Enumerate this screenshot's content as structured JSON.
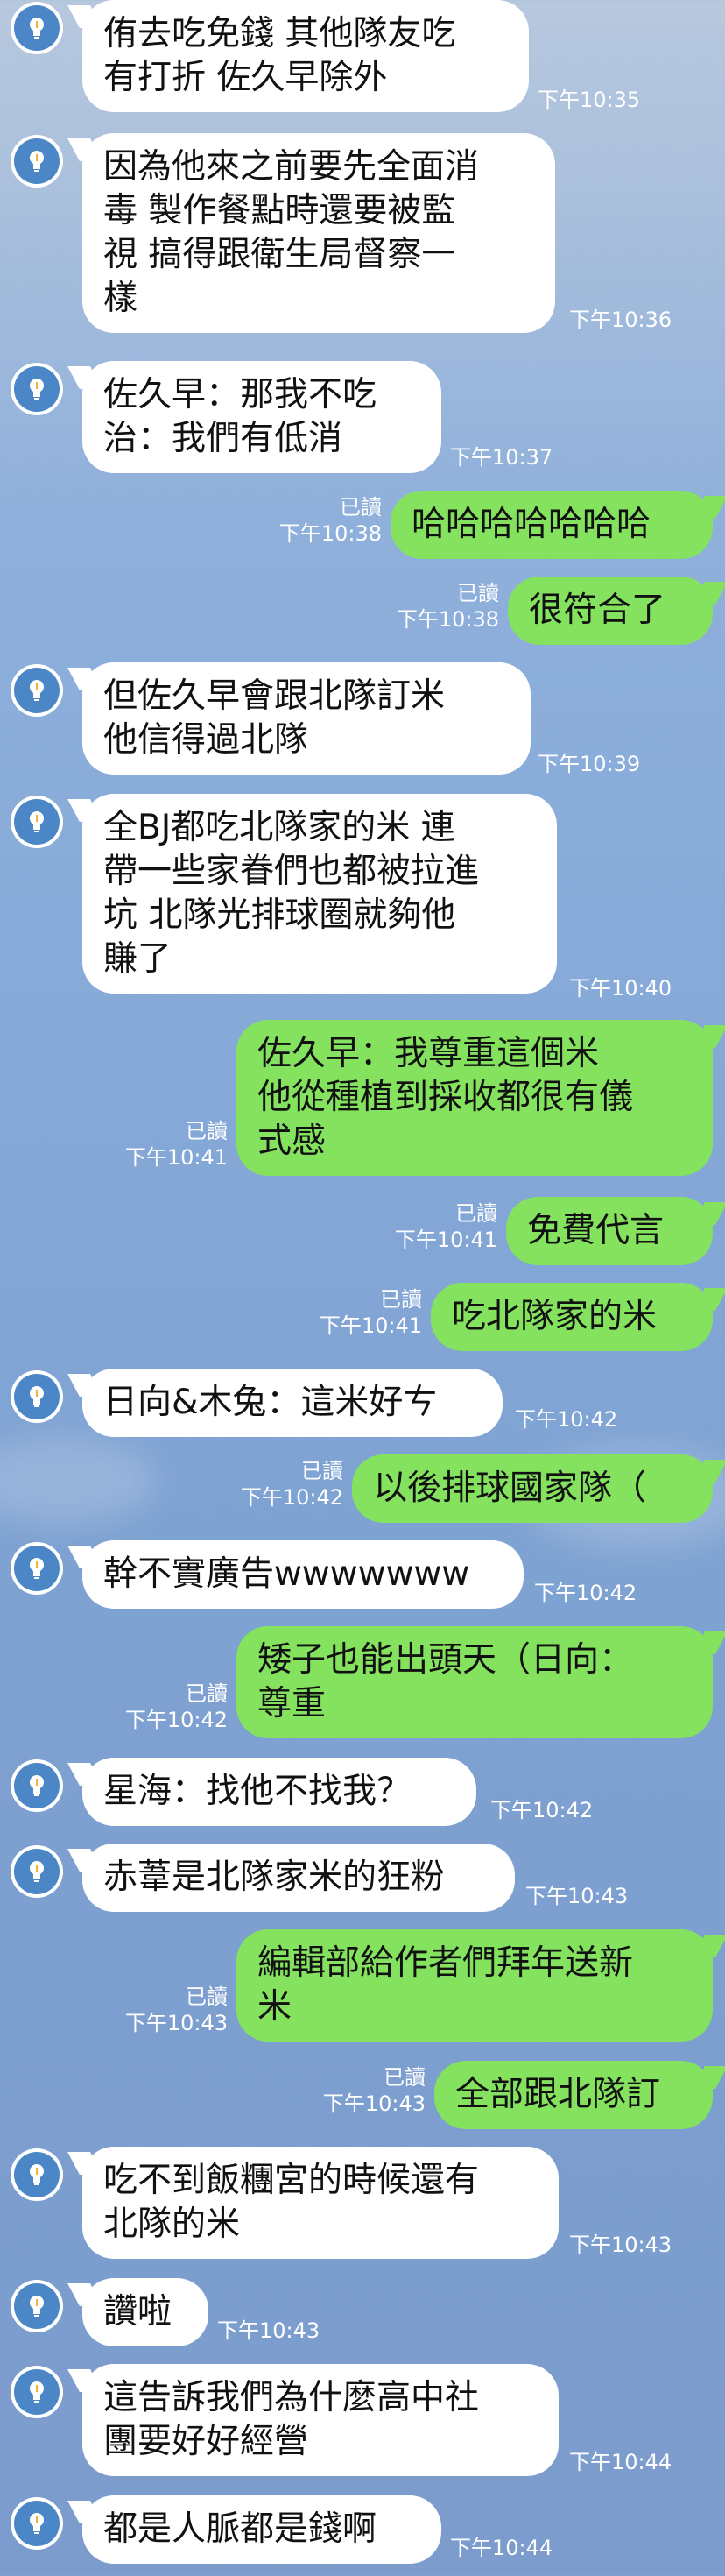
{
  "chat": {
    "messages": [
      {
        "side": "in",
        "text_lines": [
          "侑去吃免錢 其他隊友吃",
          "有打折 佐久早除外"
        ],
        "time": "下午10:35"
      },
      {
        "side": "in",
        "text_lines": [
          "因為他來之前要先全面消",
          "毒 製作餐點時還要被監",
          "視 搞得跟衛生局督察一",
          "樣"
        ],
        "time": "下午10:36"
      },
      {
        "side": "in",
        "text_lines": [
          "佐久早：那我不吃",
          "治：我們有低消"
        ],
        "time": "下午10:37"
      },
      {
        "side": "out",
        "text_lines": [
          "哈哈哈哈哈哈哈"
        ],
        "read": "已讀",
        "time": "下午10:38"
      },
      {
        "side": "out",
        "text_lines": [
          "很符合了"
        ],
        "read": "已讀",
        "time": "下午10:38"
      },
      {
        "side": "in",
        "text_lines": [
          "但佐久早會跟北隊訂米",
          "他信得過北隊"
        ],
        "time": "下午10:39"
      },
      {
        "side": "in",
        "text_lines": [
          "全BJ都吃北隊家的米 連",
          "帶一些家眷們也都被拉進",
          "坑 北隊光排球圈就夠他",
          "賺了"
        ],
        "time": "下午10:40"
      },
      {
        "side": "out",
        "text_lines": [
          "佐久早：我尊重這個米",
          "他從種植到採收都很有儀",
          "式感"
        ],
        "read": "已讀",
        "time": "下午10:41"
      },
      {
        "side": "out",
        "text_lines": [
          "免費代言"
        ],
        "read": "已讀",
        "time": "下午10:41"
      },
      {
        "side": "out",
        "text_lines": [
          "吃北隊家的米"
        ],
        "read": "已讀",
        "time": "下午10:41"
      },
      {
        "side": "in",
        "text_lines": [
          "日向&木兔：這米好ㄘ"
        ],
        "time": "下午10:42"
      },
      {
        "side": "out",
        "text_lines": [
          "以後排球國家隊（"
        ],
        "read": "已讀",
        "time": "下午10:42"
      },
      {
        "side": "in",
        "text_lines": [
          "幹不實廣告wwwwwww"
        ],
        "time": "下午10:42"
      },
      {
        "side": "out",
        "text_lines": [
          "矮子也能出頭天（日向：",
          "尊重"
        ],
        "read": "已讀",
        "time": "下午10:42"
      },
      {
        "side": "in",
        "text_lines": [
          "星海：找他不找我？"
        ],
        "time": "下午10:42"
      },
      {
        "side": "in",
        "text_lines": [
          "赤葦是北隊家米的狂粉"
        ],
        "time": "下午10:43"
      },
      {
        "side": "out",
        "text_lines": [
          "編輯部給作者們拜年送新",
          "米"
        ],
        "read": "已讀",
        "time": "下午10:43"
      },
      {
        "side": "out",
        "text_lines": [
          "全部跟北隊訂"
        ],
        "read": "已讀",
        "time": "下午10:43"
      },
      {
        "side": "in",
        "text_lines": [
          "吃不到飯糰宮的時候還有",
          "北隊的米"
        ],
        "time": "下午10:43"
      },
      {
        "side": "in",
        "text_lines": [
          "讚啦"
        ],
        "time": "下午10:43"
      },
      {
        "side": "in",
        "text_lines": [
          "這告訴我們為什麼高中社",
          "團要好好經營"
        ],
        "time": "下午10:44"
      },
      {
        "side": "in",
        "text_lines": [
          "都是人脈都是錢啊"
        ],
        "time": "下午10:44"
      }
    ]
  },
  "icons": {
    "avatar": "lightbulb-avatar-icon"
  },
  "colors": {
    "incoming_bubble": "#ffffff",
    "outgoing_bubble": "#84e25f",
    "avatar_ring": "#4b86c6",
    "meta_text": "#ffffff"
  }
}
